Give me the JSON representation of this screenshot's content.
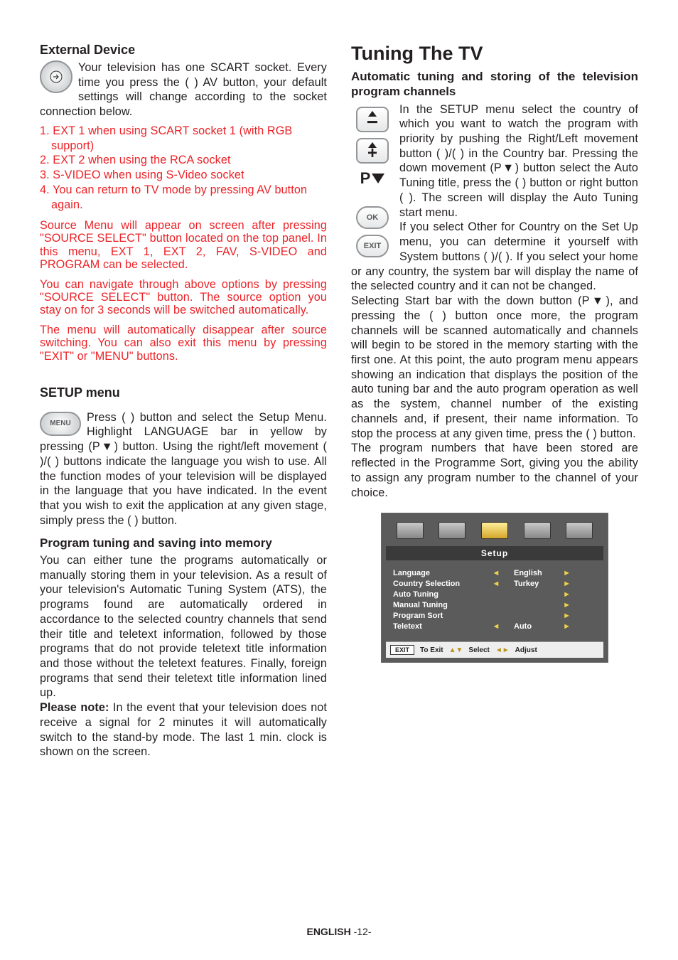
{
  "left": {
    "h_ext": "External Device",
    "p_ext": "Your television has one SCART socket. Every time you press the ( ) AV button, your default settings will change according to the socket connection below.",
    "list": [
      "1. EXT 1 when using SCART socket 1 (with RGB support)",
      "2. EXT 2 when using the RCA socket",
      "3. S-VIDEO when using S-Video socket",
      "4. You can return to TV mode by pressing AV button again."
    ],
    "red1": "Source Menu will appear on screen after pressing \"SOURCE SELECT\" button located on the top panel. In this menu, EXT 1, EXT 2, FAV, S-VIDEO and PROGRAM can be selected.",
    "red2": "You can navigate through above options by pressing \"SOURCE SELECT\" button. The source option you stay on for 3 seconds will be switched automatically.",
    "red3": "The menu will automatically disappear after source switching. You can also exit this menu by pressing \"EXIT\" or \"MENU\" buttons.",
    "h_setup": "SETUP menu",
    "p_setup": "Press ( ) button and select the Setup Menu. Highlight LANGUAGE bar in yellow by pressing (P▼) button. Using the right/left movement ( )/( ) buttons indicate the language you wish to use. All the function modes of your television will be displayed in the language that you have indicated. In the event that you wish to exit the application at any given stage, simply press the ( ) button.",
    "h_prog": "Program tuning and saving into memory",
    "p_prog": "You can either tune the programs automatically or manually storing them in your television. As a result of your television's Automatic Tuning System (ATS), the programs found are automatically ordered in accordance to the selected country channels that send their title and teletext information, followed by those programs that do not provide teletext title information and those without the teletext features. Finally, foreign programs that send their teletext title information lined up.",
    "note_b": "Please note:",
    "note": " In the event that your television does not receive a signal for 2 minutes it will automatically switch to the stand-by mode. The last 1 min. clock is shown on the screen."
  },
  "right": {
    "h_main": "Tuning The TV",
    "h_auto": "Automatic tuning and storing of the television program channels",
    "p1": "In the SETUP menu select the country of which you want to watch the program with priority by pushing the Right/Left movement button ( )/( ) in the Country bar. Pressing the down movement (P▼) button select the Auto Tuning title, press the ( ) button or right button ( ). The screen will display the Auto Tuning start menu.",
    "p2": "If you select Other for Country on the Set Up menu, you can determine it yourself with System buttons ( )/( ). If you select your home or any country, the system bar will display the name of the selected country and it can not be changed.",
    "p3": "Selecting Start bar with the down button (P▼), and pressing the ( ) button once more, the program channels will be scanned automatically and channels will begin to be stored in the memory starting with the first one.  At this point, the auto program menu appears showing an indication that displays the position of the auto tuning bar and the auto program operation as well as the system, channel number of the existing channels and, if present, their name information. To stop the process at any given time, press the ( ) button.",
    "p4": "The program numbers that have been stored are reflected in the Programme Sort, giving you the ability to assign any program number to the channel of your choice."
  },
  "tv": {
    "title": "Setup",
    "rows": [
      {
        "l": "Language",
        "m": "◄",
        "v": "English",
        "r": "►"
      },
      {
        "l": "Country Selection",
        "m": "◄",
        "v": "Turkey",
        "r": "►"
      },
      {
        "l": "Auto Tuning",
        "m": "",
        "v": "",
        "r": "►"
      },
      {
        "l": "Manual Tuning",
        "m": "",
        "v": "",
        "r": "►"
      },
      {
        "l": "Program Sort",
        "m": "",
        "v": "",
        "r": "►"
      },
      {
        "l": "Teletext",
        "m": "◄",
        "v": "Auto",
        "r": "►"
      }
    ],
    "exit": "EXIT",
    "toexit": "To Exit",
    "select": "Select",
    "adjust": "Adjust"
  },
  "footer": {
    "b": "ENGLISH",
    "n": " -12-"
  }
}
